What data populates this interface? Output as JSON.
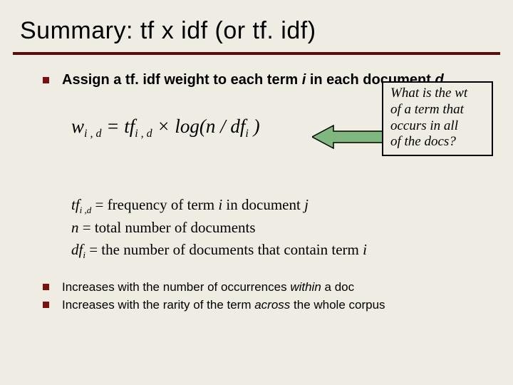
{
  "title": "Summary: tf x idf (or tf. idf)",
  "lead": {
    "pre": "Assign a tf. idf weight to each term ",
    "i": "i",
    "mid": " in each document ",
    "d": "d"
  },
  "formula": {
    "w": "w",
    "wsub": "i , d",
    "eq": " = ",
    "tf": "tf",
    "tfsub": "i , d",
    "times": " × log(",
    "n": "n",
    "slash": " / ",
    "df": "df",
    "dfsub": "i",
    "close": " )"
  },
  "callout": {
    "l1": "What is the wt",
    "l2": "of a term that",
    "l3": "occurs in all",
    "l4": "of the docs?"
  },
  "defs": {
    "line1": {
      "sym": "tf",
      "sub": "i ,d",
      "rest": " = frequency of term ",
      "i": "i",
      "rest2": " in document ",
      "j": "j"
    },
    "line2": {
      "sym": "n",
      "rest": " = total number of documents"
    },
    "line3": {
      "sym": "df",
      "sub": "i",
      "rest": " = the number of documents that contain term ",
      "i": "i"
    }
  },
  "bullets": {
    "b1": {
      "pre": "Increases with the number of occurrences ",
      "em": "within",
      "post": " a doc"
    },
    "b2": {
      "pre": "Increases with the rarity of the term ",
      "em": "across",
      "post": " the whole corpus"
    }
  }
}
